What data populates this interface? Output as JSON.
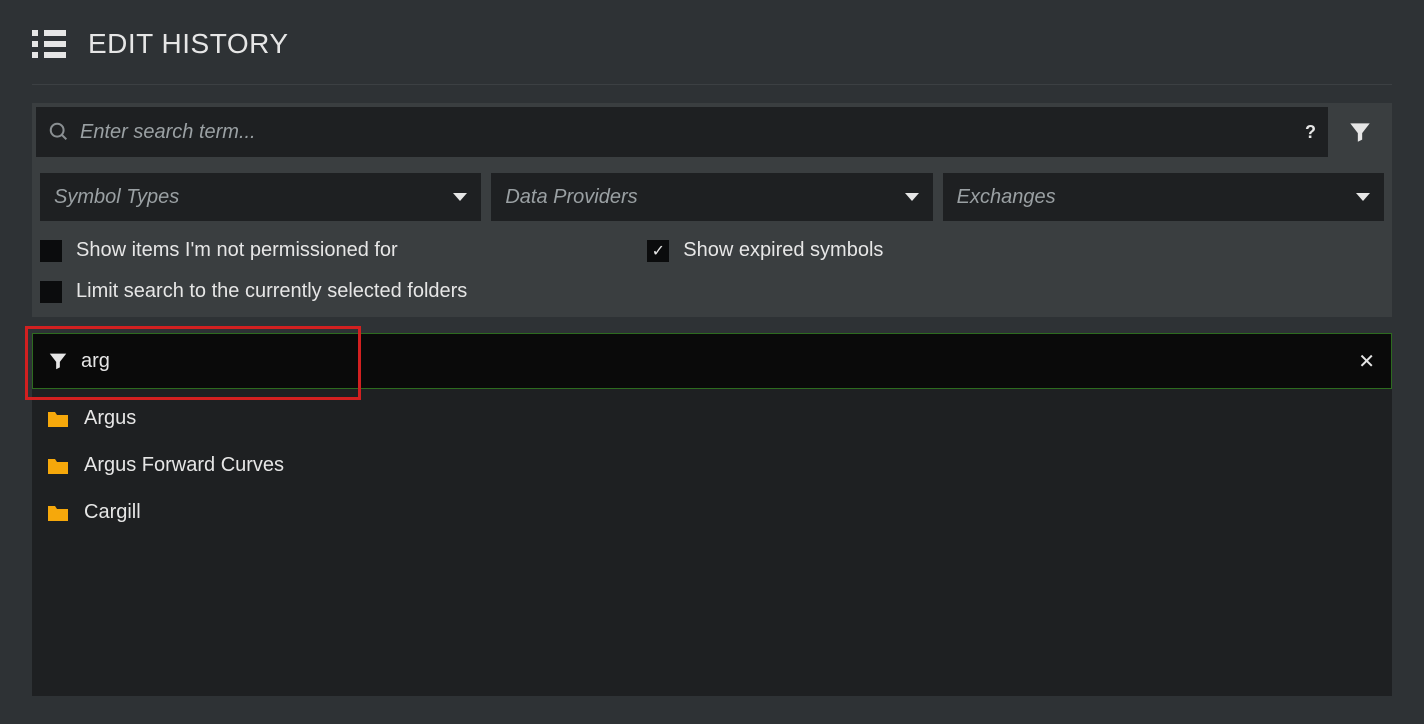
{
  "header": {
    "title": "EDIT HISTORY"
  },
  "search": {
    "placeholder": "Enter search term...",
    "help": "?"
  },
  "dropdowns": {
    "symbol_types": "Symbol Types",
    "data_providers": "Data Providers",
    "exchanges": "Exchanges"
  },
  "checks": {
    "not_permissioned": {
      "label": "Show items I'm not permissioned for",
      "checked": false
    },
    "expired": {
      "label": "Show expired symbols",
      "checked": true
    },
    "limit_folders": {
      "label": "Limit search to the currently selected folders",
      "checked": false
    }
  },
  "filter": {
    "term": "arg",
    "clear": "✕"
  },
  "results": [
    {
      "label": "Argus"
    },
    {
      "label": "Argus Forward Curves"
    },
    {
      "label": "Cargill"
    }
  ],
  "icons": {
    "folder_color": "#f6a80b"
  }
}
